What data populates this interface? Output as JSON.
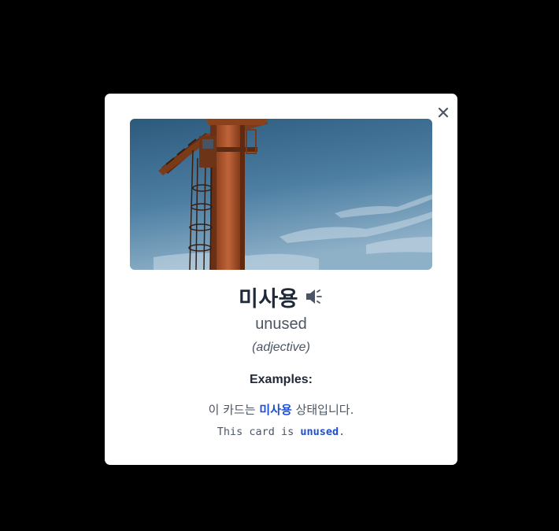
{
  "modal": {
    "close_icon": "close-icon",
    "image": {
      "subject": "orange crane tower against blue sky",
      "colors": {
        "sky_top": "#2f5f82",
        "sky_bottom": "#7ea6c2",
        "tower": "#b4582c",
        "tower_dark": "#6e3417"
      }
    },
    "word": "미사용",
    "speaker_icon": "speaker-icon",
    "translation": "unused",
    "part_of_speech": "(adjective)",
    "examples_heading": "Examples:",
    "example_ko": {
      "before": "이 카드는 ",
      "highlight": "미사용",
      "after": " 상태입니다."
    },
    "example_en": {
      "before": "This card is ",
      "highlight": "unused",
      "after": "."
    },
    "highlight_color": "#1d4ed8"
  }
}
